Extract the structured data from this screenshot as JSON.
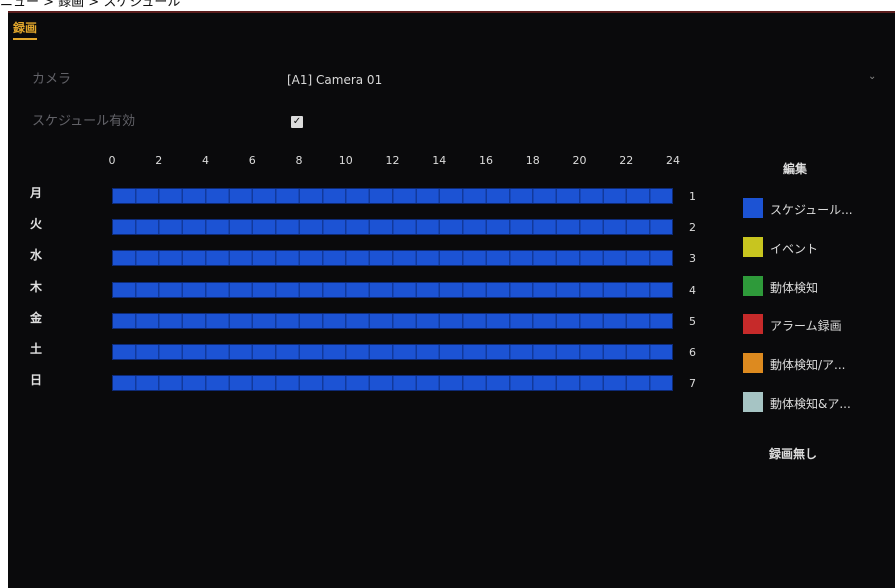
{
  "breadcrumb": "ニュー > 録画 > スケジュール",
  "tab": {
    "label": "録画"
  },
  "camera": {
    "label": "カメラ",
    "value": "[A1] Camera 01"
  },
  "schedule_enable": {
    "label": "スケジュール有効",
    "checked": true
  },
  "hours": [
    "0",
    "2",
    "4",
    "6",
    "8",
    "10",
    "12",
    "14",
    "16",
    "18",
    "20",
    "22",
    "24"
  ],
  "days": [
    {
      "label": "月",
      "num": "1"
    },
    {
      "label": "火",
      "num": "2"
    },
    {
      "label": "水",
      "num": "3"
    },
    {
      "label": "木",
      "num": "4"
    },
    {
      "label": "金",
      "num": "5"
    },
    {
      "label": "土",
      "num": "6"
    },
    {
      "label": "日",
      "num": "7"
    }
  ],
  "legend": {
    "title": "編集",
    "items": [
      {
        "label": "スケジュール...",
        "color": "#1c53d4"
      },
      {
        "label": "イベント",
        "color": "#c8c51f"
      },
      {
        "label": "動体検知",
        "color": "#2e9a3a"
      },
      {
        "label": "アラーム録画",
        "color": "#c62a2a"
      },
      {
        "label": "動体検知/ア...",
        "color": "#dd8a1f"
      },
      {
        "label": "動体検知&ア...",
        "color": "#a6c4c4"
      }
    ],
    "no_record": "録画無し"
  },
  "colors": {
    "accent": "#e2a72c",
    "schedule": "#1c53d4"
  }
}
